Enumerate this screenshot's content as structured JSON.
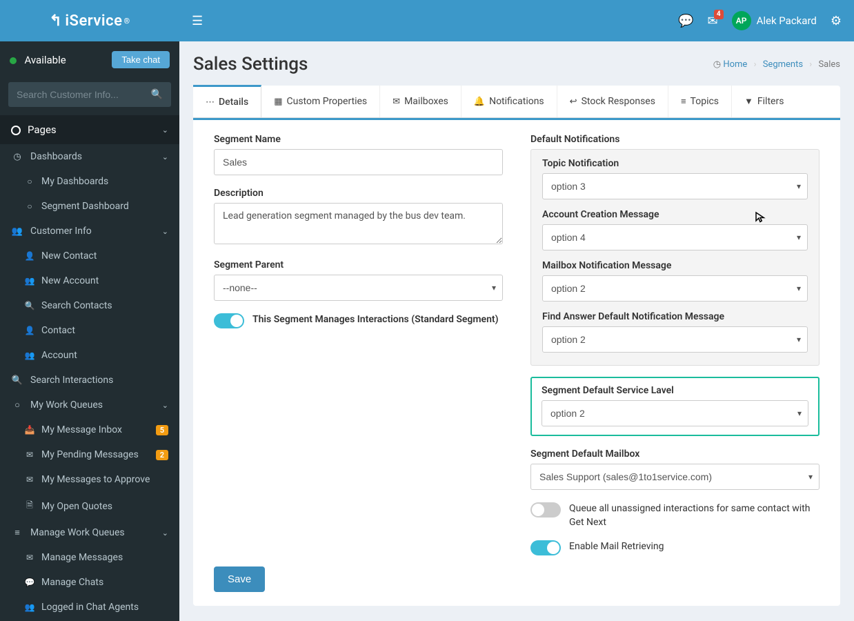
{
  "brand": {
    "name": "iService",
    "reg": "®"
  },
  "status": {
    "label": "Available",
    "take_chat": "Take chat"
  },
  "search": {
    "placeholder": "Search Customer Info..."
  },
  "nav": {
    "header": "Pages",
    "items": [
      {
        "icon": "dashboard",
        "label": "Dashboards",
        "expandable": true,
        "children": [
          {
            "icon": "circle-o",
            "label": "My Dashboards"
          },
          {
            "icon": "circle-o",
            "label": "Segment Dashboard"
          }
        ]
      },
      {
        "icon": "users",
        "label": "Customer Info",
        "expandable": true,
        "children": [
          {
            "icon": "user-plus",
            "label": "New Contact"
          },
          {
            "icon": "users-plus",
            "label": "New Account"
          },
          {
            "icon": "search",
            "label": "Search Contacts"
          },
          {
            "icon": "user",
            "label": "Contact"
          },
          {
            "icon": "users",
            "label": "Account"
          }
        ]
      },
      {
        "icon": "search",
        "label": "Search Interactions"
      },
      {
        "icon": "circle-o",
        "label": "My Work Queues",
        "expandable": true,
        "children": [
          {
            "icon": "inbox",
            "label": "My Message Inbox",
            "badge": "5"
          },
          {
            "icon": "envelope-o",
            "label": "My Pending Messages",
            "badge": "2"
          },
          {
            "icon": "check-envelope",
            "label": "My Messages to Approve"
          },
          {
            "icon": "file-o",
            "label": "My Open Quotes"
          }
        ]
      },
      {
        "icon": "list",
        "label": "Manage Work Queues",
        "expandable": true,
        "children": [
          {
            "icon": "envelope-o",
            "label": "Manage Messages"
          },
          {
            "icon": "comments",
            "label": "Manage Chats"
          },
          {
            "icon": "user-agents",
            "label": "Logged in Chat Agents"
          }
        ]
      }
    ]
  },
  "topbar": {
    "notif_count": "4",
    "user_initials": "AP",
    "user_name": "Alek Packard"
  },
  "header": {
    "title": "Sales Settings",
    "crumb_home": "Home",
    "crumb_mid": "Segments",
    "crumb_last": "Sales"
  },
  "tabs": [
    {
      "icon": "⋯",
      "label": "Details"
    },
    {
      "icon": "▦",
      "label": "Custom Properties"
    },
    {
      "icon": "✉",
      "label": "Mailboxes"
    },
    {
      "icon": "🔔",
      "label": "Notifications"
    },
    {
      "icon": "↩",
      "label": "Stock Responses"
    },
    {
      "icon": "≡",
      "label": "Topics"
    },
    {
      "icon": "▼",
      "label": "Filters"
    }
  ],
  "form": {
    "segment_name_label": "Segment Name",
    "segment_name": "Sales",
    "description_label": "Description",
    "description": "Lead generation segment managed by the bus dev team.",
    "segment_parent_label": "Segment Parent",
    "segment_parent": "--none--",
    "toggle_manages_label": "This Segment Manages Interactions (Standard Segment)",
    "notif_header": "Default Notifications",
    "topic_notif_label": "Topic Notification",
    "topic_notif": "option 3",
    "account_creation_label": "Account Creation Message",
    "account_creation": "option 4",
    "mailbox_notif_label": "Mailbox Notification Message",
    "mailbox_notif": "option 2",
    "find_answer_label": "Find Answer Default Notification Message",
    "find_answer": "option 2",
    "service_level_label": "Segment Default Service Lavel",
    "service_level": "option 2",
    "default_mailbox_label": "Segment Default Mailbox",
    "default_mailbox": "Sales Support (sales@1to1service.com)",
    "queue_toggle_label": "Queue all unassigned interactions for same contact with Get Next",
    "mail_toggle_label": "Enable Mail Retrieving",
    "save": "Save"
  }
}
